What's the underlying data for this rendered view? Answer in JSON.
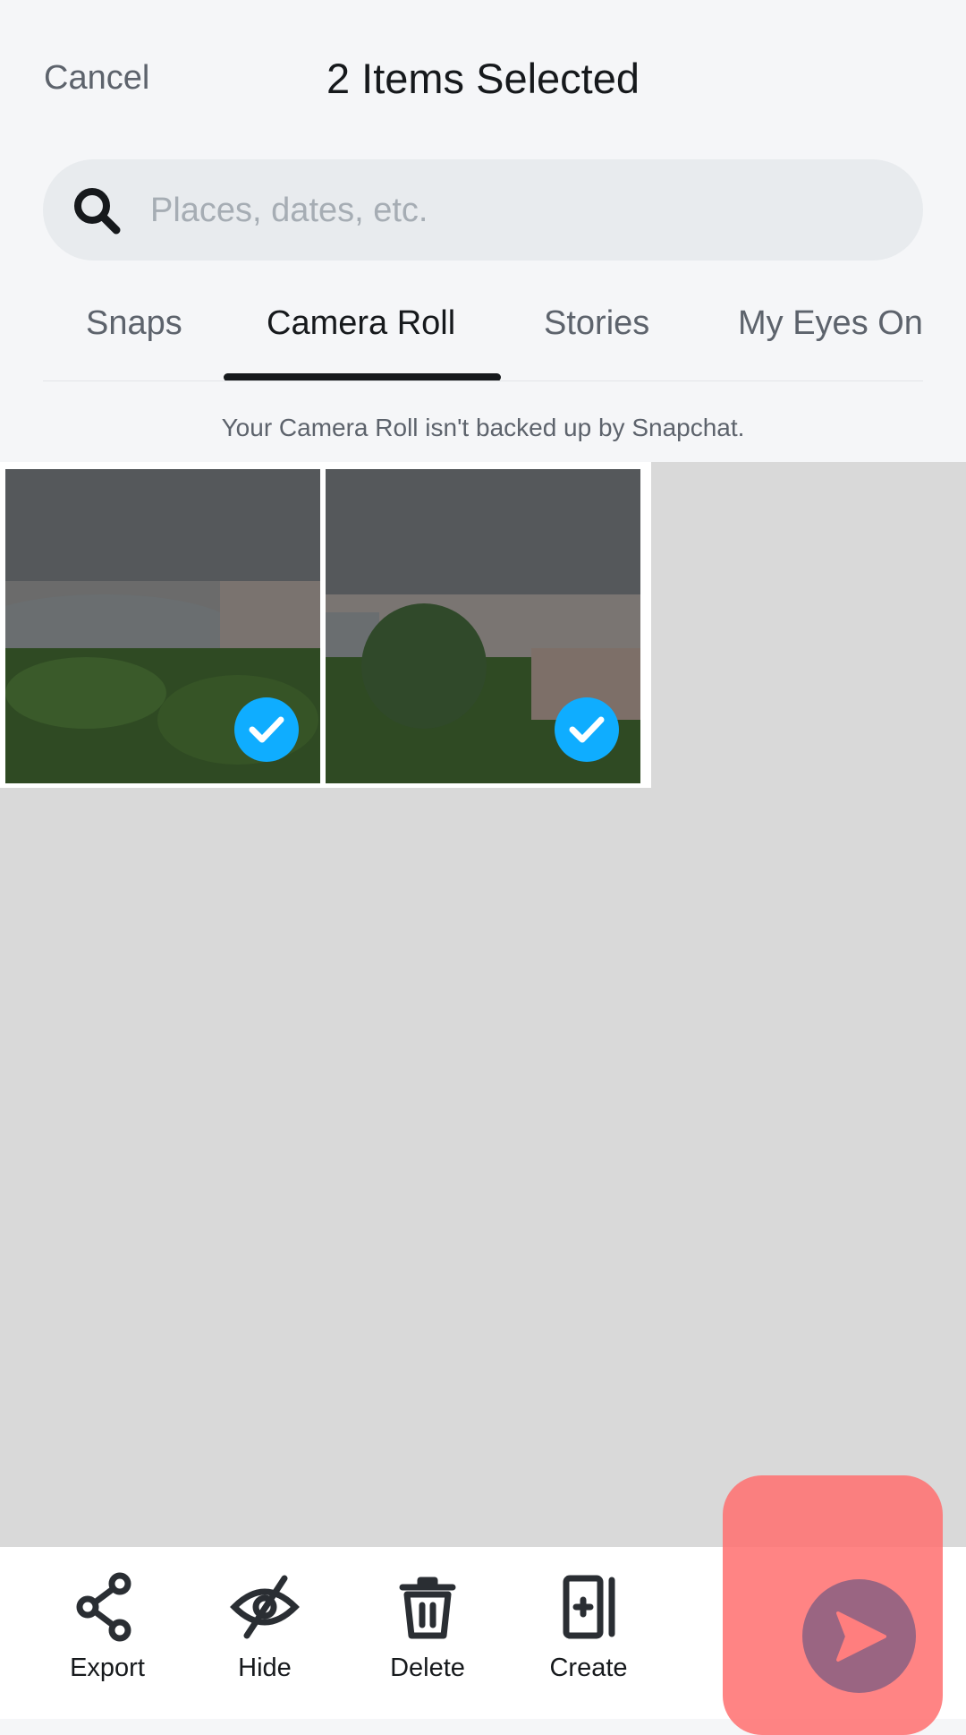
{
  "header": {
    "cancel": "Cancel",
    "title": "2 Items Selected"
  },
  "search": {
    "placeholder": "Places, dates, etc."
  },
  "tabs": [
    {
      "label": "Snaps"
    },
    {
      "label": "Camera Roll",
      "active": true
    },
    {
      "label": "Stories"
    },
    {
      "label": "My Eyes On"
    }
  ],
  "notice": "Your Camera Roll isn't backed up by Snapchat.",
  "photos": [
    {
      "selected": true
    },
    {
      "selected": true
    }
  ],
  "actions": [
    {
      "label": "Export",
      "icon": "share-icon"
    },
    {
      "label": "Hide",
      "icon": "eye-off-icon"
    },
    {
      "label": "Delete",
      "icon": "trash-icon"
    },
    {
      "label": "Create",
      "icon": "create-story-icon"
    }
  ],
  "colors": {
    "accent": "#0fadff",
    "send_button": "#9a6582",
    "overlay": "#ff6e6e"
  }
}
